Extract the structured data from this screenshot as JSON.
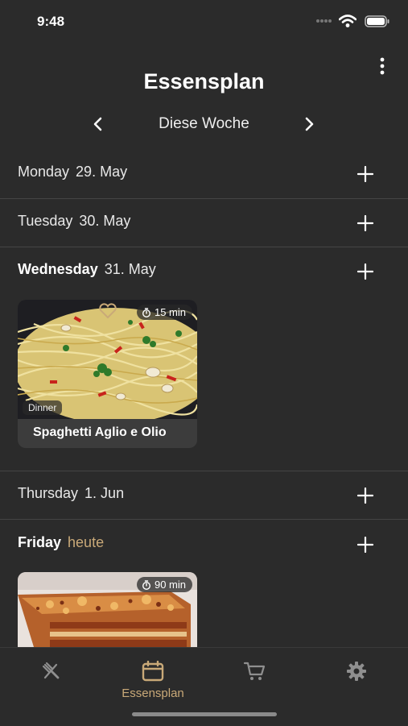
{
  "status_bar": {
    "time": "9:48"
  },
  "header": {
    "title": "Essensplan",
    "week_label": "Diese Woche"
  },
  "days": [
    {
      "weekday": "Monday",
      "date": "29. May"
    },
    {
      "weekday": "Tuesday",
      "date": "30. May"
    },
    {
      "weekday": "Wednesday",
      "date": "31. May"
    },
    {
      "weekday": "Thursday",
      "date": "1. Jun"
    },
    {
      "weekday": "Friday",
      "date": "heute"
    }
  ],
  "recipes": [
    {
      "title": "Spaghetti Aglio e Olio",
      "duration": "15 min",
      "meal": "Dinner"
    },
    {
      "duration": "90 min"
    }
  ],
  "tab_bar": {
    "active_label": "Essensplan"
  },
  "colors": {
    "accent": "#c9a978",
    "background": "#2b2b2b",
    "card": "#3c3c3c"
  }
}
